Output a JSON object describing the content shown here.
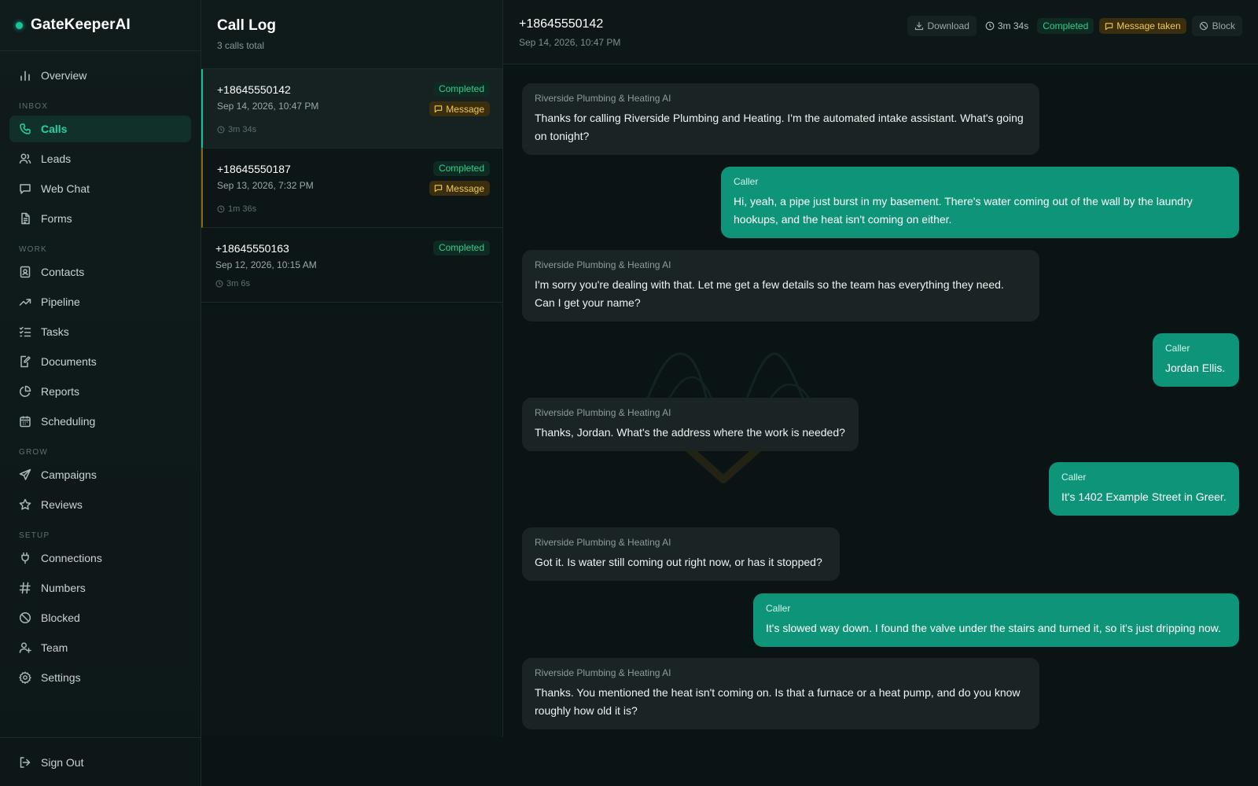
{
  "app": {
    "name": "GateKeeperAI"
  },
  "sidebar": {
    "overview": "Overview",
    "sections": {
      "inbox": "INBOX",
      "work": "WORK",
      "grow": "GROW",
      "setup": "SETUP"
    },
    "inbox": [
      {
        "label": "Calls",
        "icon": "phone-icon",
        "active": true
      },
      {
        "label": "Leads",
        "icon": "users-icon"
      },
      {
        "label": "Web Chat",
        "icon": "chat-icon"
      },
      {
        "label": "Forms",
        "icon": "file-text-icon"
      }
    ],
    "work": [
      {
        "label": "Contacts",
        "icon": "contact-card-icon"
      },
      {
        "label": "Pipeline",
        "icon": "trending-up-icon"
      },
      {
        "label": "Tasks",
        "icon": "checklist-icon"
      },
      {
        "label": "Documents",
        "icon": "document-edit-icon"
      },
      {
        "label": "Reports",
        "icon": "pie-chart-icon"
      },
      {
        "label": "Scheduling",
        "icon": "calendar-icon"
      }
    ],
    "grow": [
      {
        "label": "Campaigns",
        "icon": "send-icon"
      },
      {
        "label": "Reviews",
        "icon": "star-icon"
      }
    ],
    "setup": [
      {
        "label": "Connections",
        "icon": "plug-icon"
      },
      {
        "label": "Numbers",
        "icon": "hash-icon"
      },
      {
        "label": "Blocked",
        "icon": "ban-icon"
      },
      {
        "label": "Team",
        "icon": "user-plus-icon"
      },
      {
        "label": "Settings",
        "icon": "gear-icon"
      }
    ],
    "sign_out": "Sign Out"
  },
  "call_log": {
    "title": "Call Log",
    "subtitle": "3 calls total",
    "calls": [
      {
        "number": "+18645550142",
        "date": "Sep 14, 2026, 10:47 PM",
        "duration": "3m 34s",
        "status": "Completed",
        "tag": "Message"
      },
      {
        "number": "+18645550187",
        "date": "Sep 13, 2026, 7:32 PM",
        "duration": "1m 36s",
        "status": "Completed",
        "tag": "Message"
      },
      {
        "number": "+18645550163",
        "date": "Sep 12, 2026, 10:15 AM",
        "duration": "3m 6s",
        "status": "Completed"
      }
    ]
  },
  "conversation": {
    "number": "+18645550142",
    "date": "Sep 14, 2026, 10:47 PM",
    "toolbar": {
      "download": "Download",
      "duration": "3m 34s",
      "status": "Completed",
      "message": "Message taken",
      "block": "Block"
    },
    "messages": [
      {
        "speaker": "Riverside Plumbing & Heating AI",
        "role": "ai",
        "lines": [
          "Thanks for calling Riverside Plumbing and Heating. I'm the automated intake assistant. What's going",
          "on tonight?"
        ]
      },
      {
        "speaker": "Caller",
        "role": "caller",
        "lines": [
          "Hi, yeah, a pipe just burst in my basement. There's water coming out of the wall by the laundry",
          "hookups, and the heat isn't coming on either."
        ]
      },
      {
        "speaker": "Riverside Plumbing & Heating AI",
        "role": "ai",
        "lines": [
          "I'm sorry you're dealing with that. Let me get a few details so the team has everything they need.",
          "Can I get your name?"
        ]
      },
      {
        "speaker": "Caller",
        "role": "caller",
        "lines": [
          "Jordan Ellis."
        ]
      },
      {
        "speaker": "Riverside Plumbing & Heating AI",
        "role": "ai",
        "lines": [
          "Thanks, Jordan. What's the address where the work is needed?"
        ]
      },
      {
        "speaker": "Caller",
        "role": "caller",
        "lines": [
          "It's 1402 Example Street in Greer."
        ]
      },
      {
        "speaker": "Riverside Plumbing & Heating AI",
        "role": "ai",
        "lines": [
          "Got it. Is water still coming out right now, or has it stopped?"
        ]
      },
      {
        "speaker": "Caller",
        "role": "caller",
        "lines": [
          "It's slowed way down. I found the valve under the stairs and turned it, so it's just dripping now."
        ]
      },
      {
        "speaker": "Riverside Plumbing & Heating AI",
        "role": "ai",
        "lines": [
          "Thanks. You mentioned the heat isn't coming on. Is that a furnace or a heat pump, and do you know",
          "roughly how old it is?"
        ]
      }
    ]
  },
  "colors": {
    "accent": "#19c39a",
    "caller_bubble": "#0e9478",
    "ai_bubble": "#1a2424",
    "completed": "#2fd08b",
    "message_tag": "#f2c94c"
  }
}
